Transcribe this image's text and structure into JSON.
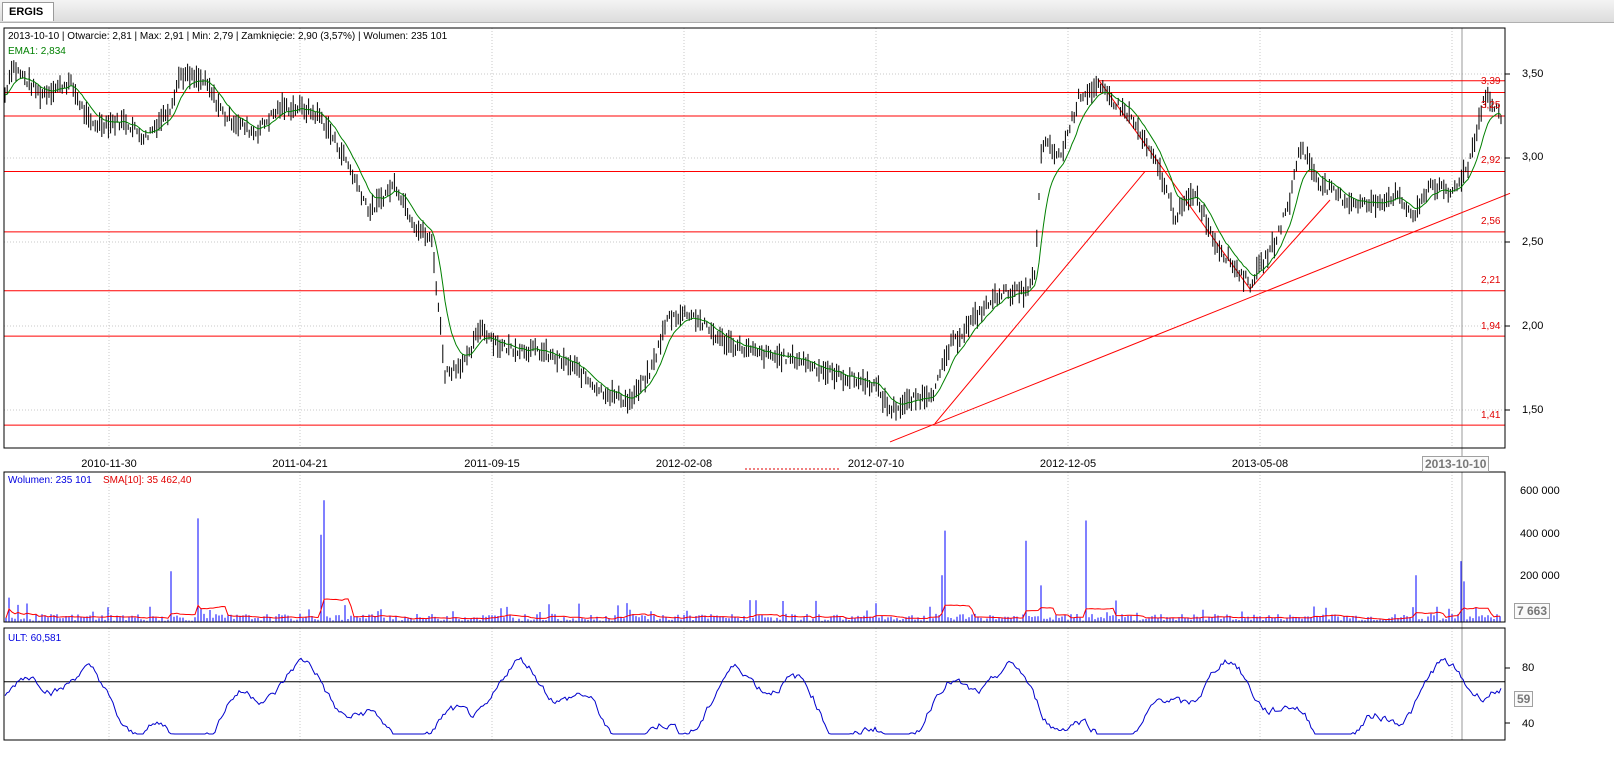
{
  "tab": {
    "label": "ERGIS"
  },
  "header": {
    "info": "2013-10-10 | Otwarcie: 2,81 | Max: 2,91 | Min: 2,79 | Zamknięcie: 2,90 (3,57%) | Wolumen: 235 101",
    "ema": "EMA1: 2,834"
  },
  "price_axis": {
    "ticks": [
      "3,50",
      "3,00",
      "2,50",
      "2,00",
      "1,50"
    ]
  },
  "date_axis": {
    "ticks": [
      "2010-11-30",
      "2011-04-21",
      "2011-09-15",
      "2012-02-08",
      "2012-07-10",
      "2012-12-05",
      "2013-05-08"
    ],
    "cursor": "2013-10-10"
  },
  "levels": [
    "3,39",
    "3,25",
    "2,92",
    "2,56",
    "2,21",
    "1,94",
    "1,41"
  ],
  "volume": {
    "legend_a": "Wolumen: 235 101",
    "legend_b": "SMA[10]: 35 462,40",
    "ticks": [
      "600 000",
      "400 000",
      "200 000"
    ],
    "cursor_value": "7 663"
  },
  "ult": {
    "legend": "ULT: 60,581",
    "ticks": [
      "80",
      "40"
    ],
    "cursor_value": "59"
  },
  "colors": {
    "level_lines": "#ff0000",
    "ema": "#008000",
    "volume": "#0000ff",
    "ult": "#0000cc"
  },
  "chart_data": [
    {
      "type": "bar",
      "title": "ERGIS",
      "x": [
        "2010-11-30",
        "2011-04-21",
        "2011-09-15",
        "2012-02-08",
        "2012-07-10",
        "2012-12-05",
        "2013-05-08",
        "2013-10-10"
      ],
      "series": [
        {
          "name": "EMA1",
          "values": [
            3.3,
            3.25,
            1.75,
            2.1,
            1.55,
            3.3,
            2.25,
            2.83
          ]
        }
      ],
      "ylim": [
        1.35,
        3.62
      ]
    },
    {
      "type": "bar",
      "series": [
        {
          "name": "Wolumen",
          "values": []
        },
        {
          "name": "SMA[10]",
          "values": []
        }
      ],
      "ylim": [
        0,
        650000
      ]
    },
    {
      "type": "line",
      "series": [
        {
          "name": "ULT",
          "values": []
        }
      ],
      "ylim": [
        30,
        100
      ]
    }
  ]
}
